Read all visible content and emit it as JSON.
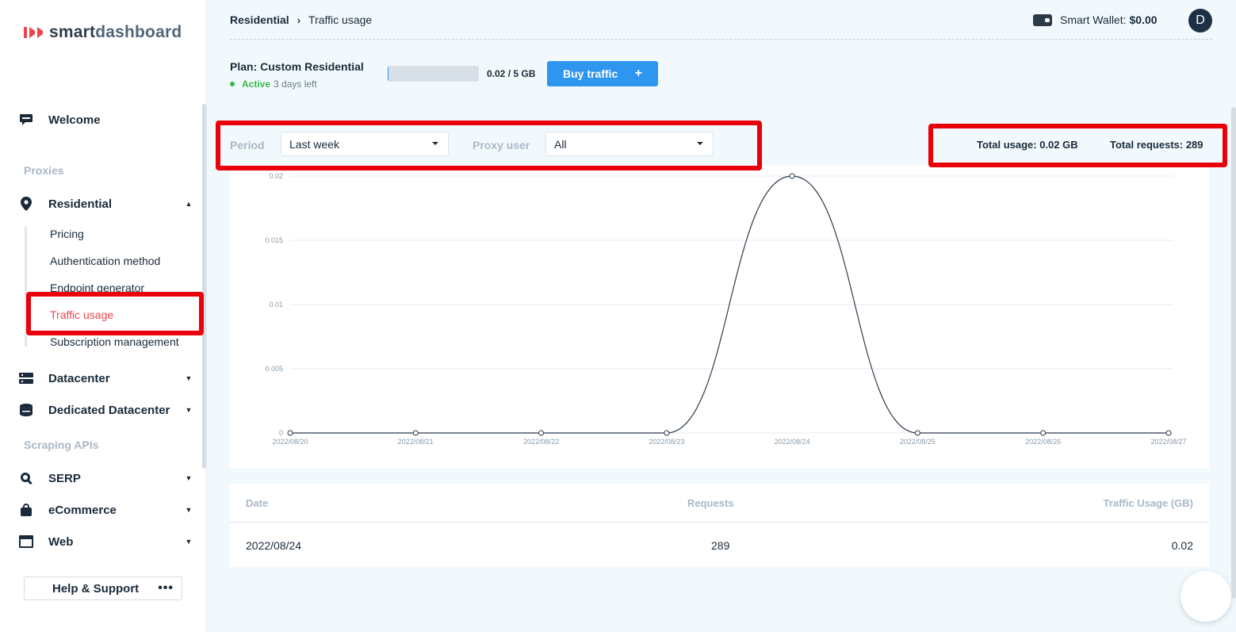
{
  "sidebar": {
    "brand_part1": "smart",
    "brand_part2": "dashboard",
    "welcome": "Welcome",
    "section_proxies": "Proxies",
    "residential": "Residential",
    "sub_items": [
      "Pricing",
      "Authentication method",
      "Endpoint generator",
      "Traffic usage",
      "Subscription management"
    ],
    "datacenter": "Datacenter",
    "dedicated_datacenter": "Dedicated Datacenter",
    "section_scraping": "Scraping APIs",
    "serp": "SERP",
    "ecommerce": "eCommerce",
    "web": "Web",
    "help": "Help & Support",
    "help_more": "•••"
  },
  "header": {
    "breadcrumb_parent": "Residential",
    "breadcrumb_sep": "›",
    "breadcrumb_current": "Traffic usage",
    "wallet_label": "Smart Wallet:",
    "wallet_value": "$0.00",
    "avatar_initial": "D"
  },
  "plan": {
    "title": "Plan: Custom Residential",
    "status": "Active",
    "days_left": "3 days left",
    "usage_text": "0.02 / 5 GB",
    "usage_fraction": 0.004,
    "buy_label": "Buy traffic",
    "buy_plus": "+"
  },
  "filters": {
    "period_label": "Period",
    "period_value": "Last week",
    "proxy_user_label": "Proxy user",
    "proxy_user_value": "All",
    "total_usage": "Total usage: 0.02 GB",
    "total_requests": "Total requests: 289"
  },
  "chart_data": {
    "type": "line",
    "x": [
      "2022/08/20",
      "2022/08/21",
      "2022/08/22",
      "2022/08/23",
      "2022/08/24",
      "2022/08/25",
      "2022/08/26",
      "2022/08/27"
    ],
    "values": [
      0,
      0,
      0,
      0,
      0.02,
      0,
      0,
      0
    ],
    "y_ticks": [
      "0.02",
      "0.015",
      "0.01",
      "0.005",
      "0"
    ],
    "ylim": [
      0,
      0.02
    ],
    "grid": true,
    "smooth": true,
    "line_color": "#2c3a4d"
  },
  "table": {
    "headers": [
      "Date",
      "Requests",
      "Traffic Usage (GB)"
    ],
    "rows": [
      [
        "2022/08/24",
        "289",
        "0.02"
      ]
    ]
  },
  "colors": {
    "accent": "#2f96f0",
    "active_nav": "#e8474f",
    "highlight_box": "#e8000b",
    "status_active": "#35b84a"
  }
}
